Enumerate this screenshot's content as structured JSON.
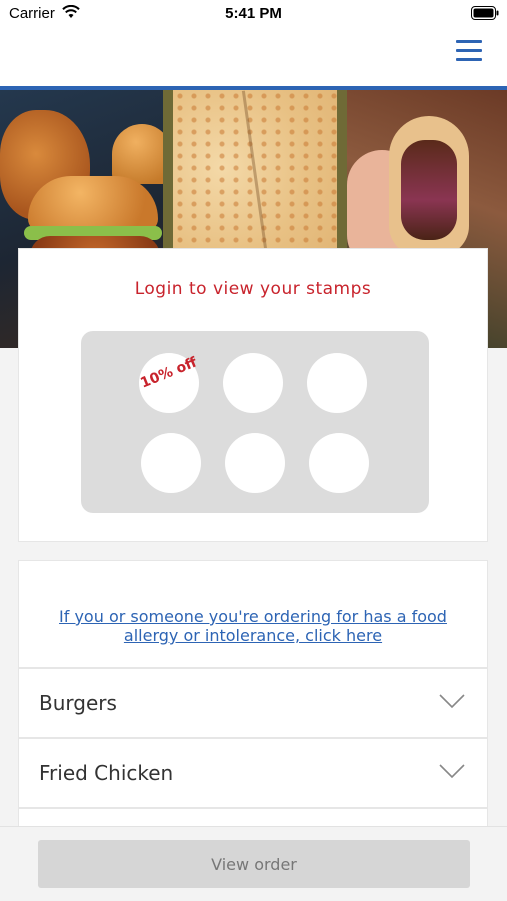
{
  "status_bar": {
    "carrier": "Carrier",
    "time": "5:41 PM"
  },
  "header": {
    "menu_icon": "hamburger-menu-icon",
    "accent_color": "#2d64b4"
  },
  "hero": {
    "panels": [
      "burgers-photo",
      "pizza-photo",
      "kebab-photo"
    ]
  },
  "stamp_card": {
    "title": "Login to view your stamps",
    "title_color": "#c8232c",
    "reward_label": "10% off",
    "total_stamps": 6
  },
  "allergy": {
    "link_text": "If you or someone you're ordering for has a food allergy or intolerance, click here",
    "link_color": "#2d64b4"
  },
  "categories": [
    {
      "label": "Burgers",
      "icon": "chevron-down-icon"
    },
    {
      "label": "Fried Chicken",
      "icon": "chevron-down-icon"
    }
  ],
  "footer": {
    "view_order_label": "View order"
  }
}
